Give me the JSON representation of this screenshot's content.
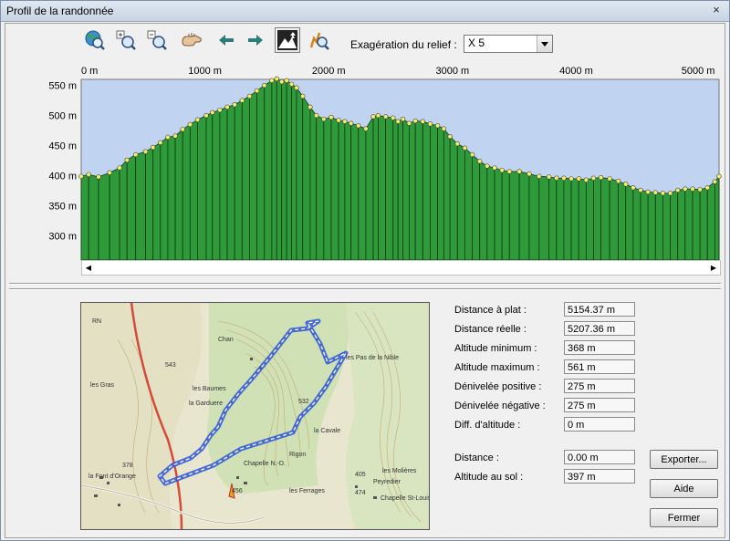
{
  "window": {
    "title": "Profil de la randonnée",
    "close_glyph": "×"
  },
  "toolbar": {
    "tools": [
      {
        "icon": "globe-search-icon"
      },
      {
        "icon": "zoom-in-icon"
      },
      {
        "icon": "zoom-out-icon"
      },
      {
        "icon": "pan-hand-icon"
      },
      {
        "icon": "arrow-left-icon"
      },
      {
        "icon": "arrow-right-icon"
      },
      {
        "icon": "terrain-trees-icon",
        "active": true
      },
      {
        "icon": "profile-magnifier-icon"
      }
    ],
    "relief_label": "Exagération du relief :",
    "relief_value": "X 5"
  },
  "chart_data": {
    "type": "area",
    "title": "",
    "x_axis": {
      "unit": "m",
      "ticks": [
        "0 m",
        "1000 m",
        "2000 m",
        "3000 m",
        "4000 m",
        "5000 m"
      ],
      "tick_values": [
        0,
        1000,
        2000,
        3000,
        4000,
        5000
      ],
      "range": [
        0,
        5154
      ],
      "position": "top"
    },
    "y_axis": {
      "unit": "m",
      "ticks": [
        "550 m",
        "500 m",
        "450 m",
        "400 m",
        "350 m",
        "300 m"
      ],
      "tick_values": [
        550,
        500,
        450,
        400,
        350,
        300
      ],
      "range": [
        260,
        560
      ]
    },
    "colors": {
      "fill": "#2e9a3a",
      "sky": "#c0d4f2",
      "point": "#f2ee6a"
    },
    "series": [
      {
        "x": [
          0,
          60,
          140,
          230,
          310,
          370,
          440,
          520,
          580,
          640,
          700,
          760,
          820,
          880,
          940,
          1010,
          1060,
          1120,
          1180,
          1240,
          1300,
          1360,
          1420,
          1480,
          1540,
          1580,
          1620,
          1660,
          1700,
          1740,
          1790,
          1850,
          1900,
          1960,
          2020,
          2080,
          2130,
          2180,
          2240,
          2300,
          2360,
          2400,
          2460,
          2520,
          2560,
          2600,
          2650,
          2700,
          2760,
          2820,
          2880,
          2930,
          2980,
          3040,
          3100,
          3160,
          3220,
          3280,
          3340,
          3400,
          3460,
          3540,
          3620,
          3700,
          3780,
          3840,
          3900,
          3960,
          4020,
          4080,
          4140,
          4200,
          4270,
          4340,
          4400,
          4460,
          4520,
          4580,
          4640,
          4700,
          4760,
          4820,
          4880,
          4940,
          5000,
          5060,
          5120,
          5154
        ],
        "y": [
          399,
          402,
          398,
          405,
          413,
          426,
          435,
          440,
          447,
          455,
          464,
          466,
          477,
          485,
          493,
          500,
          505,
          509,
          514,
          518,
          525,
          532,
          541,
          550,
          558,
          561,
          556,
          558,
          552,
          546,
          532,
          514,
          500,
          494,
          497,
          492,
          490,
          487,
          483,
          478,
          498,
          500,
          498,
          496,
          490,
          494,
          487,
          491,
          490,
          486,
          483,
          478,
          465,
          453,
          446,
          435,
          424,
          416,
          413,
          409,
          407,
          407,
          403,
          399,
          398,
          396,
          396,
          395,
          395,
          393,
          396,
          397,
          395,
          391,
          386,
          380,
          376,
          373,
          372,
          371,
          371,
          376,
          378,
          378,
          377,
          380,
          390,
          399
        ]
      }
    ]
  },
  "map": {
    "labels": [
      "RN",
      "les Gras",
      "Chan",
      "les Baumes",
      "la Garduere",
      "les Pas de la Nible",
      "la Cavale",
      "Chapelle N.-D.",
      "les Ferrages",
      "les Molières",
      "Chapelle St-Louis",
      "la Font d'Orange",
      "Peyredier",
      "Rigon",
      "543",
      "532",
      "405",
      "456",
      "378",
      "474"
    ]
  },
  "stats": {
    "rows": [
      {
        "label": "Distance à plat :",
        "value": "5154.37 m"
      },
      {
        "label": "Distance réelle :",
        "value": "5207.36 m"
      },
      {
        "label": "Altitude minimum :",
        "value": "368 m"
      },
      {
        "label": "Altitude maximum :",
        "value": "561 m"
      },
      {
        "label": "Dénivelée positive :",
        "value": "275 m"
      },
      {
        "label": "Dénivelée négative :",
        "value": "275 m"
      },
      {
        "label": "Diff. d'altitude :",
        "value": "0 m"
      }
    ],
    "cursor": [
      {
        "label": "Distance :",
        "value": "0.00 m"
      },
      {
        "label": "Altitude au sol :",
        "value": "397 m"
      }
    ]
  },
  "buttons": {
    "export": "Exporter...",
    "help": "Aide",
    "close": "Fermer"
  }
}
